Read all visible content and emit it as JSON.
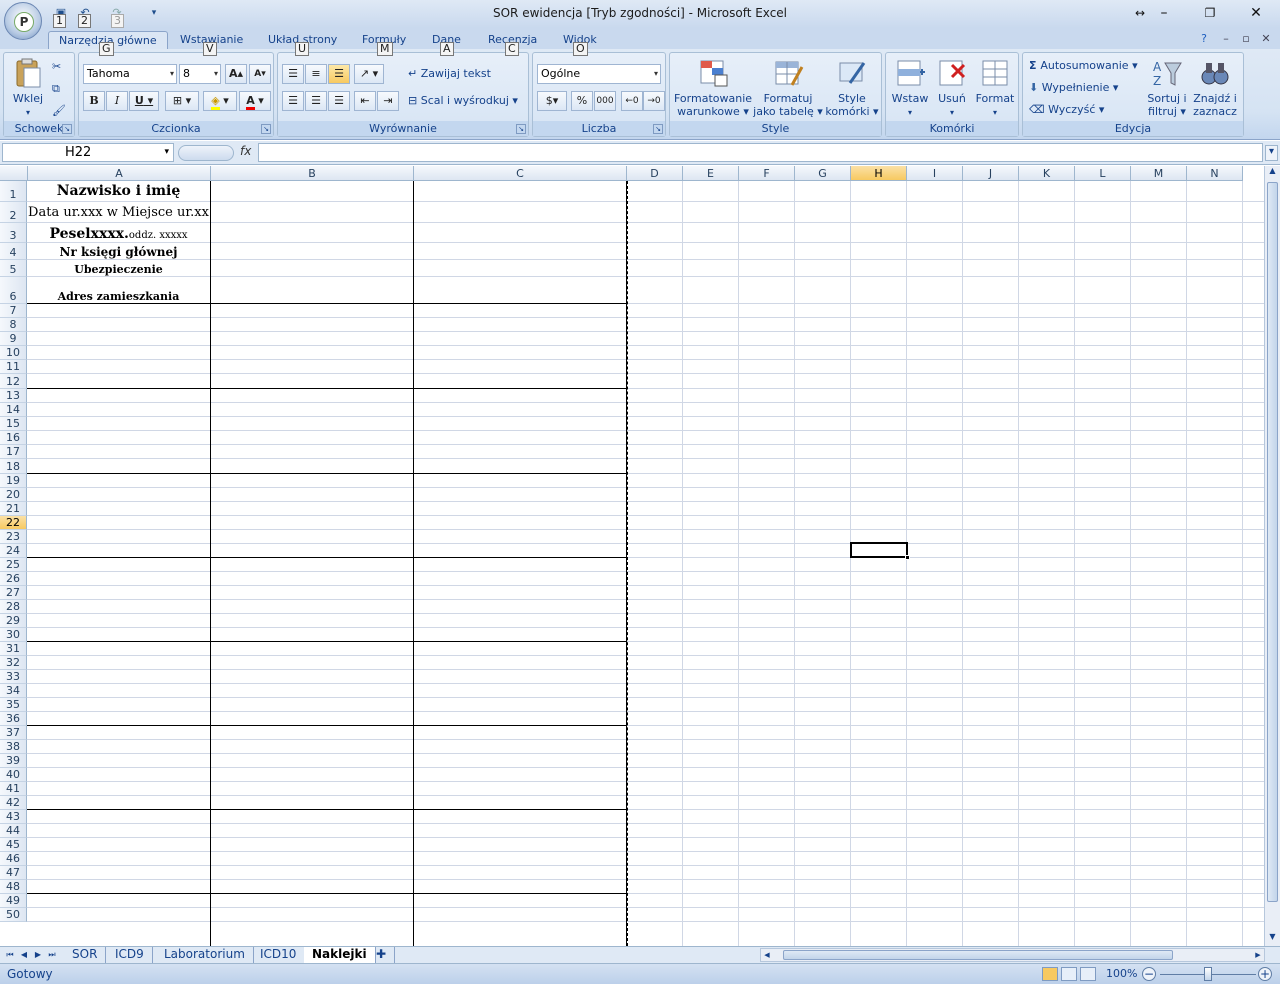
{
  "window": {
    "title": "SOR ewidencja  [Tryb zgodności] - Microsoft Excel",
    "office_button_glyph": "P",
    "keytips_qat": [
      "1",
      "2",
      "3"
    ]
  },
  "tabs": [
    {
      "label": "Narzędzia główne",
      "key": "G",
      "active": true
    },
    {
      "label": "Wstawianie",
      "key": "V"
    },
    {
      "label": "Układ strony",
      "key": "U"
    },
    {
      "label": "Formuły",
      "key": "M"
    },
    {
      "label": "Dane",
      "key": "A"
    },
    {
      "label": "Recenzja",
      "key": "C"
    },
    {
      "label": "Widok",
      "key": "O"
    }
  ],
  "ribbon": {
    "clipboard": {
      "label": "Schowek",
      "paste": "Wklej"
    },
    "font": {
      "label": "Czcionka",
      "name": "Tahoma",
      "size": "8",
      "bold": "B",
      "italic": "I",
      "underline": "U",
      "grow": "A",
      "shrink": "A"
    },
    "alignment": {
      "label": "Wyrównanie",
      "wrap": "Zawijaj tekst",
      "merge": "Scal i wyśrodkuj"
    },
    "number": {
      "label": "Liczba",
      "format": "Ogólne",
      "percent": "%",
      "thousands": "000"
    },
    "styles": {
      "label": "Style",
      "conditional_1": "Formatowanie",
      "conditional_2": "warunkowe",
      "table_1": "Formatuj",
      "table_2": "jako tabelę",
      "cell_1": "Style",
      "cell_2": "komórki"
    },
    "cells": {
      "label": "Komórki",
      "insert": "Wstaw",
      "delete": "Usuń",
      "format": "Format"
    },
    "editing": {
      "label": "Edycja",
      "autosum": "Autosumowanie",
      "fill": "Wypełnienie",
      "clear": "Wyczyść",
      "sort_1": "Sortuj i",
      "sort_2": "filtruj",
      "find_1": "Znajdź i",
      "find_2": "zaznacz"
    }
  },
  "formula_bar": {
    "name_box": "H22",
    "fx": "fx",
    "formula": ""
  },
  "columns": [
    "A",
    "B",
    "C",
    "D",
    "E",
    "F",
    "G",
    "H",
    "I",
    "J",
    "K",
    "L",
    "M",
    "N"
  ],
  "selected_column": "H",
  "selected_row": "22",
  "rows": [
    "1",
    "2",
    "3",
    "4",
    "5",
    "6",
    "7",
    "8",
    "9",
    "10",
    "11",
    "12",
    "13",
    "14",
    "15",
    "16",
    "17",
    "18",
    "19",
    "20",
    "21",
    "22",
    "23",
    "24",
    "25",
    "26",
    "27",
    "28",
    "29",
    "30",
    "31",
    "32",
    "33",
    "34",
    "35",
    "36",
    "37",
    "38",
    "39",
    "40",
    "41",
    "42",
    "43",
    "44",
    "45",
    "46",
    "47",
    "48",
    "49",
    "50"
  ],
  "cells": {
    "a1": "Nazwisko i imię",
    "a2": "Data ur.xxx w Miejsce ur.xx",
    "a3_main": "Peselxxxx.",
    "a3_small": "oddz. xxxxx",
    "a4": "Nr księgi głównej",
    "a5": "Ubezpieczenie",
    "a6": "Adres zamieszkania"
  },
  "sheets": [
    {
      "name": "SOR"
    },
    {
      "name": "ICD9"
    },
    {
      "name": "Laboratorium"
    },
    {
      "name": "ICD10"
    },
    {
      "name": "Naklejki",
      "active": true
    }
  ],
  "status": {
    "text": "Gotowy",
    "zoom": "100%"
  }
}
